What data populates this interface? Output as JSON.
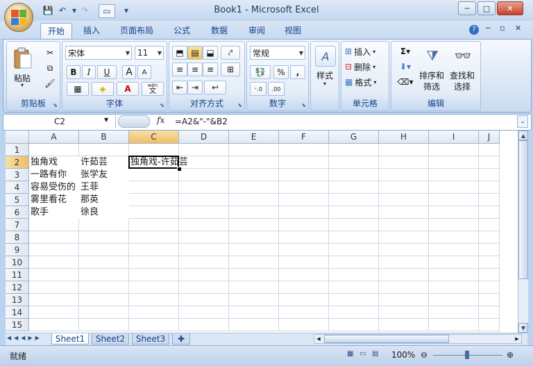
{
  "window": {
    "title": "Book1 - Microsoft Excel",
    "min": "─",
    "max": "□",
    "close": "✕"
  },
  "qat": {
    "save": "💾",
    "undo": "↶",
    "redo": "↷",
    "more": "▾"
  },
  "tabs": [
    "开始",
    "插入",
    "页面布局",
    "公式",
    "数据",
    "审阅",
    "视图"
  ],
  "ribbon": {
    "clipboard": {
      "label": "剪贴板",
      "paste": "粘贴"
    },
    "font": {
      "label": "字体",
      "name": "宋体",
      "size": "11",
      "bold": "B",
      "italic": "I",
      "underline": "U",
      "grow": "A",
      "shrink": "A",
      "color_a": "A",
      "wen": "wén",
      "wen_char": "文"
    },
    "align": {
      "label": "对齐方式"
    },
    "number": {
      "label": "数字",
      "format": "常规",
      "percent": "%",
      "comma": ","
    },
    "styles": {
      "label": "样式"
    },
    "cells": {
      "label": "单元格",
      "insert": "插入",
      "delete": "删除",
      "format": "格式"
    },
    "editing": {
      "label": "编辑",
      "sort": "排序和",
      "sort2": "筛选",
      "find": "查找和",
      "find2": "选择"
    }
  },
  "formula_bar": {
    "name_box": "C2",
    "fx": "fx",
    "formula": "=A2&\"-\"&B2"
  },
  "grid": {
    "columns": [
      "A",
      "B",
      "C",
      "D",
      "E",
      "F",
      "G",
      "H",
      "I",
      "J"
    ],
    "rows": [
      "1",
      "2",
      "3",
      "4",
      "5",
      "6",
      "7",
      "8",
      "9",
      "10",
      "11",
      "12",
      "13",
      "14",
      "15"
    ],
    "cells": {
      "A2": "独角戏",
      "B2": "许茹芸",
      "C2": "独角戏-许茹芸",
      "A3": "一路有你",
      "B3": "张学友",
      "A4": "容易受伤的",
      "B4": "王菲",
      "A5": "雾里看花",
      "B5": "那英",
      "A6": "歌手",
      "B6": "徐良"
    }
  },
  "sheets": [
    "Sheet1",
    "Sheet2",
    "Sheet3"
  ],
  "status": {
    "ready": "就绪",
    "zoom": "100%"
  },
  "colors": {
    "selected_header": "#f0bf66",
    "accent": "#15428b"
  }
}
